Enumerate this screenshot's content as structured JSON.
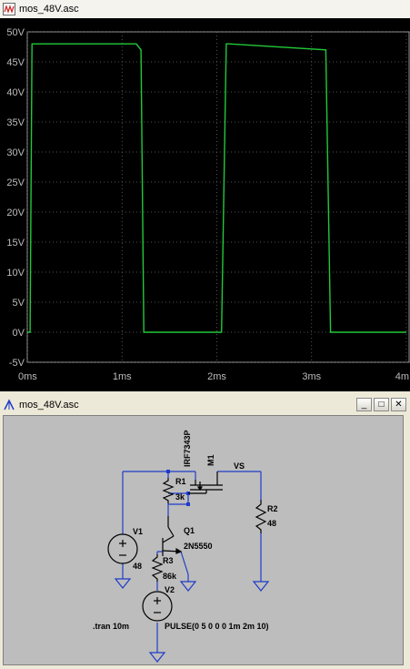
{
  "plot_window": {
    "title": "mos_48V.asc",
    "icon": "waveform-icon"
  },
  "chart_data": {
    "type": "line",
    "title": "",
    "xlabel": "",
    "ylabel": "",
    "x_ticks": [
      "0ms",
      "1ms",
      "2ms",
      "3ms",
      "4m"
    ],
    "y_ticks": [
      "50V",
      "45V",
      "40V",
      "35V",
      "30V",
      "25V",
      "20V",
      "15V",
      "10V",
      "5V",
      "0V",
      "-5V"
    ],
    "xlim": [
      0,
      4
    ],
    "ylim": [
      -5,
      50
    ],
    "grid": true,
    "background": "#000000",
    "series": [
      {
        "color": "#22c83a",
        "x": [
          0.0,
          0.03,
          0.05,
          1.15,
          1.2,
          1.23,
          2.05,
          2.1,
          2.13,
          3.15,
          3.2,
          3.23,
          4.0
        ],
        "y": [
          0,
          0,
          48,
          48,
          47,
          0,
          0,
          48,
          48,
          47,
          0,
          0,
          0
        ]
      }
    ]
  },
  "schematic_window": {
    "title": "mos_48V.asc",
    "icon": "schematic-icon",
    "minimize_label": "_",
    "maximize_label": "□",
    "close_label": "✕",
    "labels": {
      "m1_part": "IRF7343P",
      "m1_name": "M1",
      "vs_net": "VS",
      "r1_name": "R1",
      "r1_value": "3k",
      "v1_name": "V1",
      "v1_value": "48",
      "q1_name": "Q1",
      "q1_part": "2N5550",
      "r2_name": "R2",
      "r2_value": "48",
      "r3_name": "R3",
      "r3_value": "86k",
      "v2_name": "V2",
      "directive": ".tran 10m",
      "v2_value": "PULSE(0 5 0 0 0 1m 2m 10)"
    },
    "wire_color": "#1e3cc8",
    "ground_color": "#1e3cc8",
    "component_color": "#000000"
  }
}
